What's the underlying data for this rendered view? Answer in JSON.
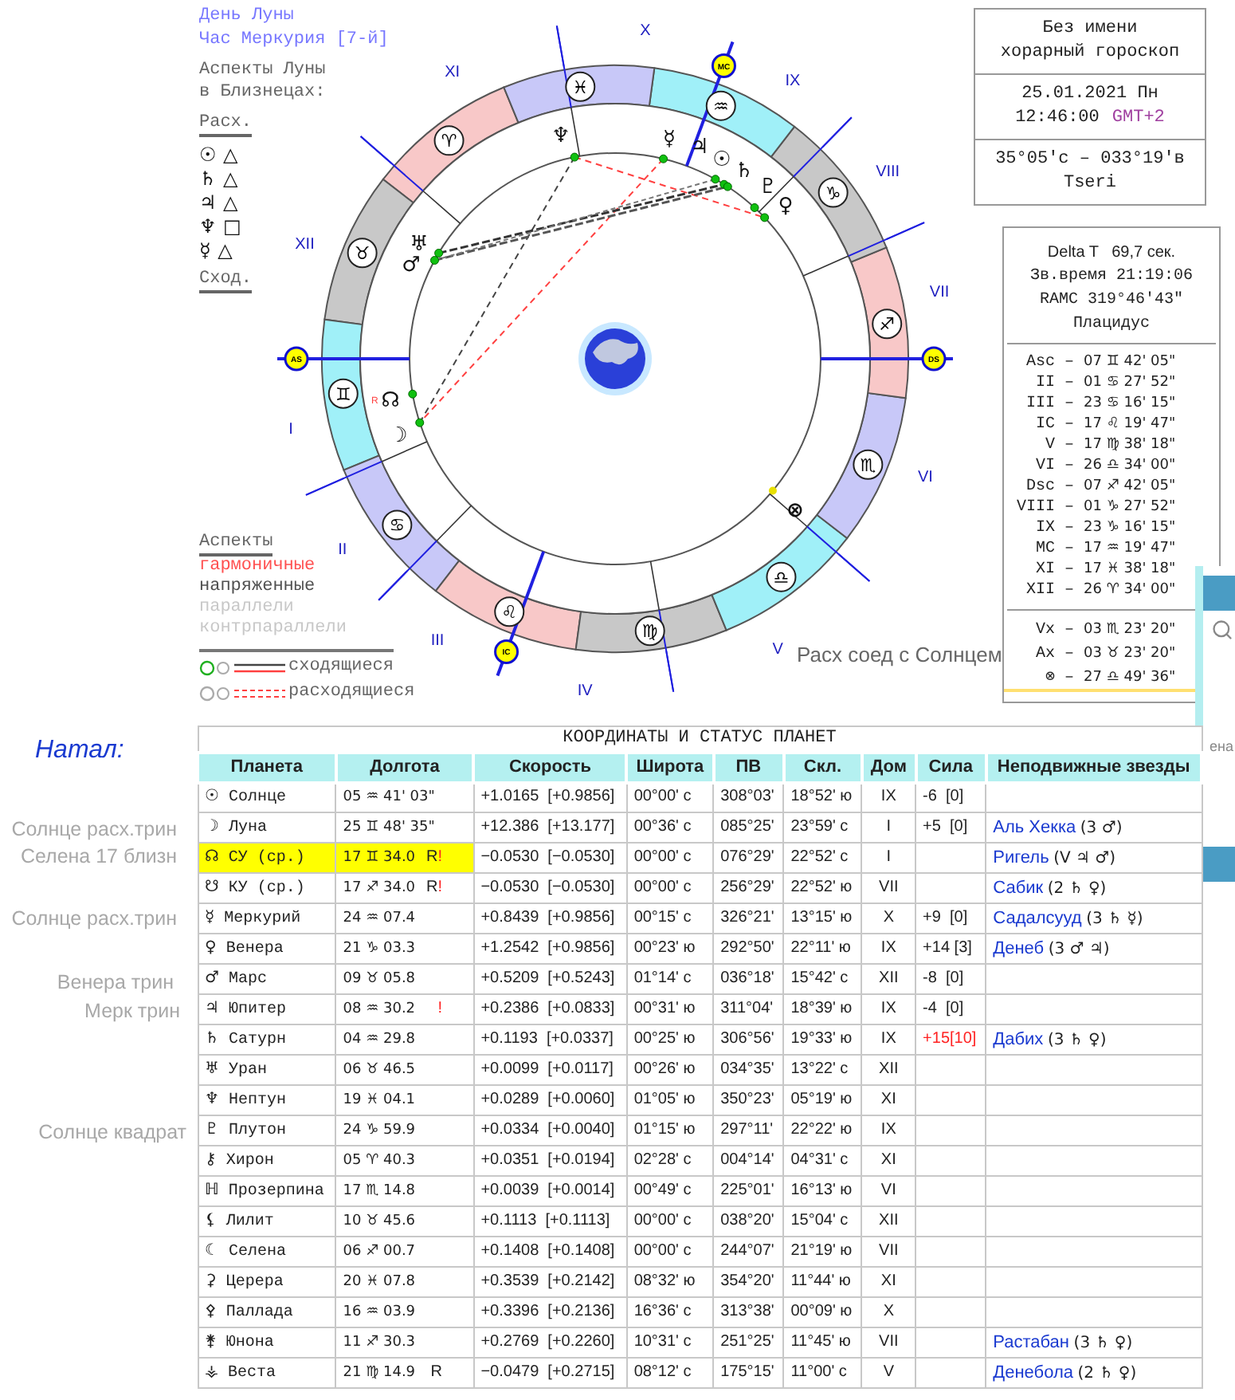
{
  "day_info": [
    "День Луны",
    "Час Меркурия [7-й]"
  ],
  "moon_aspects": {
    "title_lines": [
      "Аспекты Луны",
      "в Близнецах:"
    ],
    "separating_label": "Расх.",
    "applying_label": "Сход.",
    "separating": [
      {
        "planet": "☉",
        "aspect": "△"
      },
      {
        "planet": "♄",
        "aspect": "△"
      },
      {
        "planet": "♃",
        "aspect": "△"
      },
      {
        "planet": "♆",
        "aspect": "□"
      },
      {
        "planet": "☿",
        "aspect": "△"
      }
    ]
  },
  "aspect_legend": {
    "title": "Аспекты",
    "items": [
      {
        "label": "гармоничные",
        "color": "#ff5050"
      },
      {
        "label": "напряженные",
        "color": "#505050"
      },
      {
        "label": "параллели",
        "color": "#c8c8c8"
      },
      {
        "label": "контрпараллели",
        "color": "#c8c8c8"
      }
    ],
    "line_types": [
      {
        "kind": "applying",
        "label": "сходящиеся"
      },
      {
        "kind": "separating",
        "label": "расходящиеся"
      }
    ]
  },
  "wheel": {
    "house_numbers": [
      "I",
      "II",
      "III",
      "IV",
      "V",
      "VI",
      "VII",
      "VIII",
      "IX",
      "X",
      "XI",
      "XII"
    ],
    "signs": [
      {
        "glyph": "♈",
        "color": "#f8c8c8"
      },
      {
        "glyph": "♉",
        "color": "#c8c8c8"
      },
      {
        "glyph": "♊",
        "color": "#a0f0f8"
      },
      {
        "glyph": "♋",
        "color": "#c8c8f8"
      },
      {
        "glyph": "♌",
        "color": "#f8c8c8"
      },
      {
        "glyph": "♍",
        "color": "#c8c8c8"
      },
      {
        "glyph": "♎",
        "color": "#a0f0f8"
      },
      {
        "glyph": "♏",
        "color": "#c8c8f8"
      },
      {
        "glyph": "♐",
        "color": "#f8c8c8"
      },
      {
        "glyph": "♑",
        "color": "#c8c8c8"
      },
      {
        "glyph": "♒",
        "color": "#a0f0f8"
      },
      {
        "glyph": "♓",
        "color": "#c8c8f8"
      }
    ],
    "planets": [
      "♆",
      "☿",
      "♃",
      "☉",
      "♄",
      "♇",
      "♀",
      "♅",
      "♂",
      "☊",
      "☽",
      "⊗"
    ],
    "retro_mark": "R",
    "axes": [
      "AS",
      "MC",
      "DS",
      "IC"
    ]
  },
  "annotation": "Расх соед с Солнцем",
  "chart_info": {
    "name_lines": [
      "Без имени",
      "хорарный гороскоп"
    ],
    "date": "25.01.2021 Пн",
    "time": "12:46:00",
    "timezone": "GMT+2",
    "coords": "35°05'с – 033°19'в",
    "place": "Tseri"
  },
  "house_info": {
    "delta_t": "Delta T   69,7 сек.",
    "sidereal": "Зв.время 21:19:06",
    "ramc": "RAMC 319°46'43\"",
    "system": "Плацидус",
    "separator": "–",
    "cusps": [
      {
        "label": "Asc",
        "value": "07 ♊ 42' 05\""
      },
      {
        "label": "II",
        "value": "01 ♋ 27' 52\""
      },
      {
        "label": "III",
        "value": "23 ♋ 16' 15\""
      },
      {
        "label": "IC",
        "value": "17 ♌ 19' 47\""
      },
      {
        "label": "V",
        "value": "17 ♍ 38' 18\""
      },
      {
        "label": "VI",
        "value": "26 ♎ 34' 00\""
      },
      {
        "label": "Dsc",
        "value": "07 ♐ 42' 05\""
      },
      {
        "label": "VIII",
        "value": "01 ♑ 27' 52\""
      },
      {
        "label": "IX",
        "value": "23 ♑ 16' 15\""
      },
      {
        "label": "MC",
        "value": "17 ♒ 19' 47\""
      },
      {
        "label": "XI",
        "value": "17 ♓ 38' 18\""
      },
      {
        "label": "XII",
        "value": "26 ♈ 34' 00\""
      }
    ],
    "points": [
      {
        "label": "Vx",
        "value": "03 ♏ 23' 20\"",
        "underlined": false
      },
      {
        "label": "Ax",
        "value": "03 ♉ 23' 20\"",
        "underlined": false
      },
      {
        "label": "⊗",
        "value": "27 ♎ 49' 36\"",
        "underlined": true
      }
    ]
  },
  "notes": [
    {
      "text": "Натал:",
      "kind": "heading"
    },
    {
      "text": "Солнце расх.трин",
      "kind": "note"
    },
    {
      "text": "Селена 17 близн",
      "kind": "note"
    },
    {
      "text": "Солнце расх.трин",
      "kind": "note"
    },
    {
      "text": "Венера трин",
      "kind": "note"
    },
    {
      "text": "Мерк трин",
      "kind": "note"
    },
    {
      "text": "Солнце квадрат",
      "kind": "note"
    }
  ],
  "background_window": {
    "text": "ена"
  },
  "table": {
    "title": "КООРДИНАТЫ И СТАТУС ПЛАНЕТ",
    "columns": [
      "Планета",
      "Долгота",
      "Скорость",
      "Широта",
      "ПВ",
      "Скл.",
      "Дом",
      "Сила",
      "Неподвижные звезды"
    ],
    "rows": [
      {
        "glyph": "☉",
        "name": "Солнце",
        "longitude": "05 ♒ 41' 03\"",
        "speed": "+1.0165  [+0.9856]",
        "latitude": "00°00' с",
        "pv": "308°03'",
        "decl": "18°52' ю",
        "house": "IX",
        "strength": "-6  [0]",
        "strength_alert": false,
        "highlighted": false
      },
      {
        "glyph": "☽",
        "name": "Луна",
        "longitude": "25 ♊ 48' 35\"",
        "speed": "+12.386  [+13.177]",
        "latitude": "00°36' с",
        "pv": "085°25'",
        "decl": "23°59' с",
        "house": "I",
        "strength": "+5  [0]",
        "strength_alert": false,
        "star": "Аль Хекка",
        "star_note": "(3 ♂)",
        "highlighted": false
      },
      {
        "glyph": "☊",
        "name": "СУ  (ср.)",
        "longitude": "17 ♊ 34.0",
        "retro": "R",
        "alert": "!",
        "speed": "−0.0530  [−0.0530]",
        "latitude": "00°00' с",
        "pv": "076°29'",
        "decl": "22°52' с",
        "house": "I",
        "star": "Ригель",
        "star_note": "(V ♃ ♂)",
        "highlighted": true
      },
      {
        "glyph": "☋",
        "name": "КУ  (ср.)",
        "longitude": "17 ♐ 34.0",
        "retro": "R",
        "alert": "!",
        "speed": "−0.0530  [−0.0530]",
        "latitude": "00°00' с",
        "pv": "256°29'",
        "decl": "22°52' ю",
        "house": "VII",
        "star": "Сабик",
        "star_note": "(2 ♄ ♀)",
        "highlighted": false
      },
      {
        "glyph": "☿",
        "name": "Меркурий",
        "longitude": "24 ♒ 07.4",
        "speed": "+0.8439  [+0.9856]",
        "latitude": "00°15' с",
        "pv": "326°21'",
        "decl": "13°15' ю",
        "house": "X",
        "strength": "+9  [0]",
        "strength_alert": false,
        "star": "Садалсууд",
        "star_note": "(3 ♄ ☿)",
        "highlighted": false
      },
      {
        "glyph": "♀",
        "name": "Венера",
        "longitude": "21 ♑ 03.3",
        "speed": "+1.2542  [+0.9856]",
        "latitude": "00°23' ю",
        "pv": "292°50'",
        "decl": "22°11' ю",
        "house": "IX",
        "strength": "+14 [3]",
        "strength_alert": false,
        "star": "Денеб",
        "star_note": "(3 ♂ ♃)",
        "highlighted": false
      },
      {
        "glyph": "♂",
        "name": "Марс",
        "longitude": "09 ♉ 05.8",
        "speed": "+0.5209  [+0.5243]",
        "latitude": "01°14' с",
        "pv": "036°18'",
        "decl": "15°42' с",
        "house": "XII",
        "strength": "-8  [0]",
        "strength_alert": false,
        "highlighted": false
      },
      {
        "glyph": "♃",
        "name": "Юпитер",
        "longitude": "08 ♒ 30.2",
        "alert": "!",
        "speed": "+0.2386  [+0.0833]",
        "latitude": "00°31' ю",
        "pv": "311°04'",
        "decl": "18°39' ю",
        "house": "IX",
        "strength": "-4  [0]",
        "strength_alert": false,
        "highlighted": false
      },
      {
        "glyph": "♄",
        "name": "Сатурн",
        "longitude": "04 ♒ 29.8",
        "speed": "+0.1193  [+0.0337]",
        "latitude": "00°25' ю",
        "pv": "306°56'",
        "decl": "19°33' ю",
        "house": "IX",
        "strength": "+15[10]",
        "strength_alert": true,
        "star": "Дабих",
        "star_note": "(3 ♄ ♀)",
        "highlighted": false
      },
      {
        "glyph": "♅",
        "name": "Уран",
        "longitude": "06 ♉ 46.5",
        "speed": "+0.0099  [+0.0117]",
        "latitude": "00°26' ю",
        "pv": "034°35'",
        "decl": "13°22' с",
        "house": "XII",
        "highlighted": false
      },
      {
        "glyph": "♆",
        "name": "Нептун",
        "longitude": "19 ♓ 04.1",
        "speed": "+0.0289  [+0.0060]",
        "latitude": "01°05' ю",
        "pv": "350°23'",
        "decl": "05°19' ю",
        "house": "XI",
        "highlighted": false
      },
      {
        "glyph": "♇",
        "name": "Плутон",
        "longitude": "24 ♑ 59.9",
        "speed": "+0.0334  [+0.0040]",
        "latitude": "01°15' ю",
        "pv": "297°11'",
        "decl": "22°22' ю",
        "house": "IX",
        "highlighted": false
      },
      {
        "glyph": "⚷",
        "name": "Хирон",
        "longitude": "05 ♈ 40.3",
        "speed": "+0.0351  [+0.0194]",
        "latitude": "02°28' с",
        "pv": "004°14'",
        "decl": "04°31' с",
        "house": "XI",
        "highlighted": false
      },
      {
        "glyph": "ℍ",
        "name": "Прозерпина",
        "longitude": "17 ♏ 14.8",
        "speed": "+0.0039  [+0.0014]",
        "latitude": "00°49' с",
        "pv": "225°01'",
        "decl": "16°13' ю",
        "house": "VI",
        "highlighted": false
      },
      {
        "glyph": "⚸",
        "name": "Лилит",
        "longitude": "10 ♉ 45.6",
        "speed": "+0.1113  [+0.1113]",
        "latitude": "00°00' с",
        "pv": "038°20'",
        "decl": "15°04' с",
        "house": "XII",
        "highlighted": false
      },
      {
        "glyph": "☾",
        "name": "Селена",
        "longitude": "06 ♐ 00.7",
        "speed": "+0.1408  [+0.1408]",
        "latitude": "00°00' с",
        "pv": "244°07'",
        "decl": "21°19' ю",
        "house": "VII",
        "highlighted": false
      },
      {
        "glyph": "⚳",
        "name": "Церера",
        "longitude": "20 ♓ 07.8",
        "speed": "+0.3539  [+0.2142]",
        "latitude": "08°32' ю",
        "pv": "354°20'",
        "decl": "11°44' ю",
        "house": "XI",
        "highlighted": false
      },
      {
        "glyph": "⚴",
        "name": "Паллада",
        "longitude": "16 ♒ 03.9",
        "speed": "+0.3396  [+0.2136]",
        "latitude": "16°36' с",
        "pv": "313°38'",
        "decl": "00°09' ю",
        "house": "X",
        "highlighted": false
      },
      {
        "glyph": "⚵",
        "name": "Юнона",
        "longitude": "11 ♐ 30.3",
        "speed": "+0.2769  [+0.2260]",
        "latitude": "10°31' с",
        "pv": "251°25'",
        "decl": "11°45' ю",
        "house": "VII",
        "star": "Растабан",
        "star_note": "(3 ♄ ♀)",
        "highlighted": false
      },
      {
        "glyph": "⚶",
        "name": "Веста",
        "longitude": "21 ♍ 14.9",
        "retro": "R",
        "speed": "−0.0479  [+0.2715]",
        "latitude": "08°12' с",
        "pv": "175°15'",
        "decl": "11°00' с",
        "house": "V",
        "star": "Денебола",
        "star_note": "(2 ♄ ♀)",
        "highlighted": false
      }
    ]
  }
}
